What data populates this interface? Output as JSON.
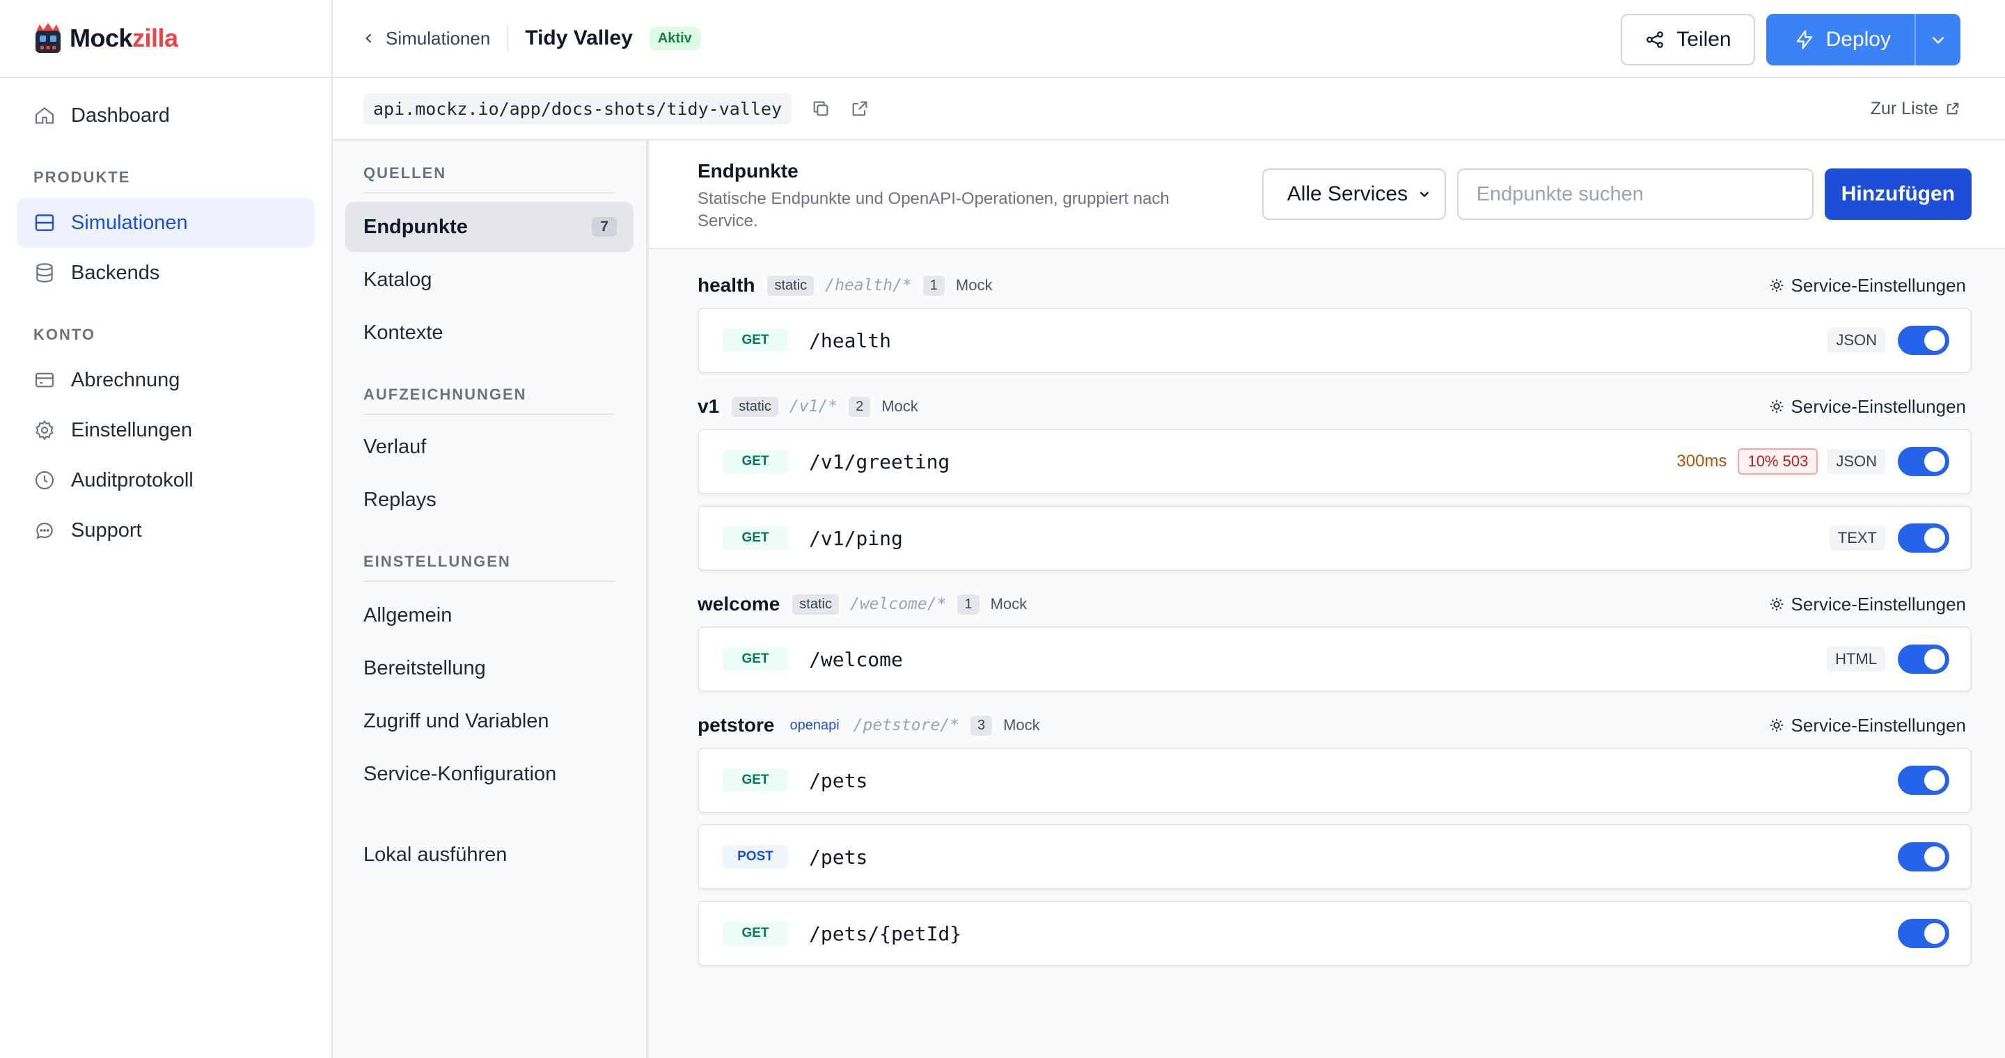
{
  "brand": {
    "part1": "Mock",
    "part2": "zilla"
  },
  "sidebar": {
    "top_items": [
      {
        "label": "Dashboard",
        "icon": "home-icon"
      }
    ],
    "sections": [
      {
        "title": "PRODUKTE",
        "items": [
          {
            "label": "Simulationen",
            "icon": "layout-icon",
            "active": true
          },
          {
            "label": "Backends",
            "icon": "database-icon"
          }
        ]
      },
      {
        "title": "KONTO",
        "items": [
          {
            "label": "Abrechnung",
            "icon": "credit-card-icon"
          },
          {
            "label": "Einstellungen",
            "icon": "gear-icon"
          },
          {
            "label": "Auditprotokoll",
            "icon": "clock-icon"
          },
          {
            "label": "Support",
            "icon": "chat-icon"
          }
        ]
      }
    ]
  },
  "header": {
    "back_label": "Simulationen",
    "title": "Tidy Valley",
    "status": "Aktiv",
    "share_label": "Teilen",
    "deploy_label": "Deploy"
  },
  "urlbar": {
    "url": "api.mockz.io/app/docs-shots/tidy-valley",
    "list_link": "Zur Liste"
  },
  "subnav": {
    "sections": [
      {
        "title": "QUELLEN",
        "items": [
          {
            "label": "Endpunkte",
            "count": "7",
            "active": true
          },
          {
            "label": "Katalog"
          },
          {
            "label": "Kontexte"
          }
        ]
      },
      {
        "title": "AUFZEICHNUNGEN",
        "items": [
          {
            "label": "Verlauf"
          },
          {
            "label": "Replays"
          }
        ]
      },
      {
        "title": "EINSTELLUNGEN",
        "items": [
          {
            "label": "Allgemein"
          },
          {
            "label": "Bereitstellung"
          },
          {
            "label": "Zugriff und Variablen"
          },
          {
            "label": "Service-Konfiguration"
          }
        ]
      }
    ],
    "footer_item": "Lokal ausführen"
  },
  "panel": {
    "title": "Endpunkte",
    "description": "Statische Endpunkte und OpenAPI-Operationen, gruppiert nach Service.",
    "filter_value": "Alle Services",
    "search_placeholder": "Endpunkte suchen",
    "add_label": "Hinzufügen",
    "settings_label": "Service-Einstellungen"
  },
  "services": [
    {
      "name": "health",
      "kind": "static",
      "path": "/health/*",
      "count": "1",
      "type": "Mock",
      "endpoints": [
        {
          "method": "GET",
          "path": "/health",
          "format": "JSON",
          "enabled": true
        }
      ]
    },
    {
      "name": "v1",
      "kind": "static",
      "path": "/v1/*",
      "count": "2",
      "type": "Mock",
      "endpoints": [
        {
          "method": "GET",
          "path": "/v1/greeting",
          "latency": "300ms",
          "error": "10% 503",
          "format": "JSON",
          "enabled": true
        },
        {
          "method": "GET",
          "path": "/v1/ping",
          "format": "TEXT",
          "enabled": true
        }
      ]
    },
    {
      "name": "welcome",
      "kind": "static",
      "path": "/welcome/*",
      "count": "1",
      "type": "Mock",
      "endpoints": [
        {
          "method": "GET",
          "path": "/welcome",
          "format": "HTML",
          "enabled": true
        }
      ]
    },
    {
      "name": "petstore",
      "kind": "openapi",
      "path": "/petstore/*",
      "count": "3",
      "type": "Mock",
      "endpoints": [
        {
          "method": "GET",
          "path": "/pets",
          "enabled": true
        },
        {
          "method": "POST",
          "path": "/pets",
          "enabled": true
        },
        {
          "method": "GET",
          "path": "/pets/{petId}",
          "enabled": true
        }
      ]
    }
  ],
  "colors": {
    "accent": "#2563eb",
    "brand_red": "#ef4444",
    "active_bg": "#eef2ff"
  }
}
